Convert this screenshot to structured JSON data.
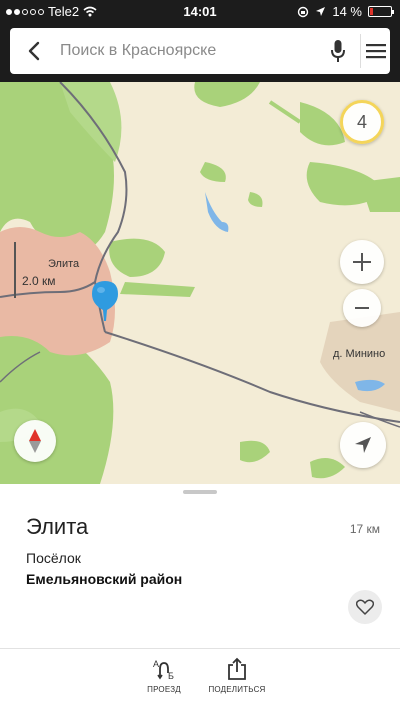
{
  "status_bar": {
    "carrier": "Tele2",
    "signal_dots_filled": 2,
    "signal_dots_total": 5,
    "time": "14:01",
    "battery": "14 %",
    "battery_level": 0.14,
    "battery_color": "#e0342b"
  },
  "search": {
    "placeholder": "Поиск в Красноярске"
  },
  "map": {
    "traffic_level": "4",
    "scale_label": "2.0 км",
    "labels": {
      "elita": "Элита",
      "minino": "д. Минино"
    }
  },
  "place": {
    "title": "Элита",
    "distance": "17 км",
    "type": "Посёлок",
    "region": "Емельяновский район"
  },
  "toolbar": {
    "route_label": "ПРОЕЗД",
    "share_label": "ПОДЕЛИТЬСЯ"
  },
  "colors": {
    "accent_pin": "#2f9be0",
    "traffic_ring": "#f4d55a",
    "forest": "#a9d27a",
    "land": "#f3ecd6",
    "settlement": "#e9b9a4"
  },
  "icons": {
    "back": "chevron-left-icon",
    "mic": "microphone-icon",
    "menu": "hamburger-icon",
    "zoom_in": "plus-icon",
    "zoom_out": "minus-icon",
    "locate": "location-arrow-icon",
    "compass": "compass-icon",
    "pin": "map-pin-icon",
    "favorite": "heart-icon",
    "route": "route-icon",
    "share": "share-icon"
  }
}
